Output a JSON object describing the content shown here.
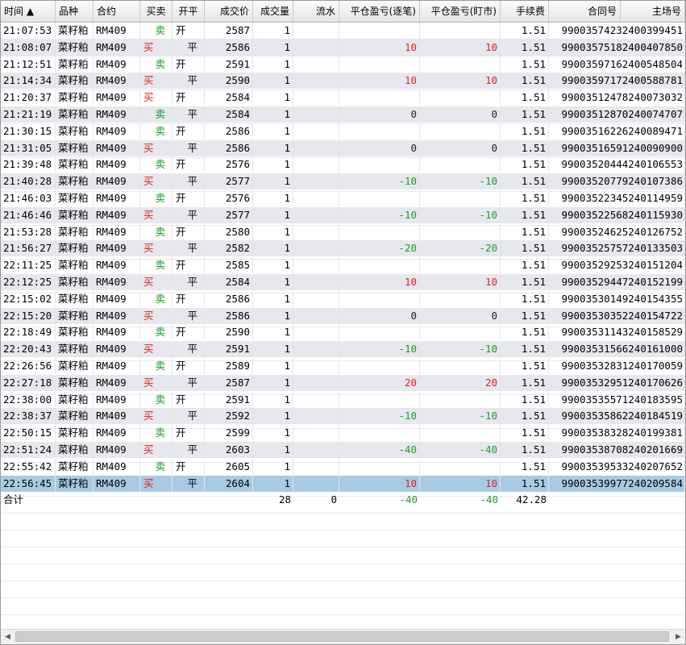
{
  "columns": [
    "时间 ▲",
    "品种",
    "合约",
    "买卖",
    "开平",
    "成交价",
    "成交量",
    "流水",
    "平仓盈亏(逐笔)",
    "平仓盈亏(盯市)",
    "手续费",
    "合同号",
    "主场号"
  ],
  "rows": [
    [
      "21:07:53",
      "菜籽粕",
      "RM409",
      "卖",
      "开",
      "2587",
      "1",
      "",
      "",
      "",
      "1.51",
      "99003574232400399451"
    ],
    [
      "21:08:07",
      "菜籽粕",
      "RM409",
      "买",
      "平",
      "2586",
      "1",
      "",
      "10",
      "10",
      "1.51",
      "99003575182400407850"
    ],
    [
      "21:12:51",
      "菜籽粕",
      "RM409",
      "卖",
      "开",
      "2591",
      "1",
      "",
      "",
      "",
      "1.51",
      "99003597162400548504"
    ],
    [
      "21:14:34",
      "菜籽粕",
      "RM409",
      "买",
      "平",
      "2590",
      "1",
      "",
      "10",
      "10",
      "1.51",
      "99003597172400588781"
    ],
    [
      "21:20:37",
      "菜籽粕",
      "RM409",
      "买",
      "开",
      "2584",
      "1",
      "",
      "",
      "",
      "1.51",
      "99003512478240073032"
    ],
    [
      "21:21:19",
      "菜籽粕",
      "RM409",
      "卖",
      "平",
      "2584",
      "1",
      "",
      "0",
      "0",
      "1.51",
      "99003512870240074707"
    ],
    [
      "21:30:15",
      "菜籽粕",
      "RM409",
      "卖",
      "开",
      "2586",
      "1",
      "",
      "",
      "",
      "1.51",
      "99003516226240089471"
    ],
    [
      "21:31:05",
      "菜籽粕",
      "RM409",
      "买",
      "平",
      "2586",
      "1",
      "",
      "0",
      "0",
      "1.51",
      "99003516591240090900"
    ],
    [
      "21:39:48",
      "菜籽粕",
      "RM409",
      "卖",
      "开",
      "2576",
      "1",
      "",
      "",
      "",
      "1.51",
      "99003520444240106553"
    ],
    [
      "21:40:28",
      "菜籽粕",
      "RM409",
      "买",
      "平",
      "2577",
      "1",
      "",
      "-10",
      "-10",
      "1.51",
      "99003520779240107386"
    ],
    [
      "21:46:03",
      "菜籽粕",
      "RM409",
      "卖",
      "开",
      "2576",
      "1",
      "",
      "",
      "",
      "1.51",
      "99003522345240114959"
    ],
    [
      "21:46:46",
      "菜籽粕",
      "RM409",
      "买",
      "平",
      "2577",
      "1",
      "",
      "-10",
      "-10",
      "1.51",
      "99003522568240115930"
    ],
    [
      "21:53:28",
      "菜籽粕",
      "RM409",
      "卖",
      "开",
      "2580",
      "1",
      "",
      "",
      "",
      "1.51",
      "99003524625240126752"
    ],
    [
      "21:56:27",
      "菜籽粕",
      "RM409",
      "买",
      "平",
      "2582",
      "1",
      "",
      "-20",
      "-20",
      "1.51",
      "99003525757240133503"
    ],
    [
      "22:11:25",
      "菜籽粕",
      "RM409",
      "卖",
      "开",
      "2585",
      "1",
      "",
      "",
      "",
      "1.51",
      "99003529253240151204"
    ],
    [
      "22:12:25",
      "菜籽粕",
      "RM409",
      "买",
      "平",
      "2584",
      "1",
      "",
      "10",
      "10",
      "1.51",
      "99003529447240152199"
    ],
    [
      "22:15:02",
      "菜籽粕",
      "RM409",
      "卖",
      "开",
      "2586",
      "1",
      "",
      "",
      "",
      "1.51",
      "99003530149240154355"
    ],
    [
      "22:15:20",
      "菜籽粕",
      "RM409",
      "买",
      "平",
      "2586",
      "1",
      "",
      "0",
      "0",
      "1.51",
      "99003530352240154722"
    ],
    [
      "22:18:49",
      "菜籽粕",
      "RM409",
      "卖",
      "开",
      "2590",
      "1",
      "",
      "",
      "",
      "1.51",
      "99003531143240158529"
    ],
    [
      "22:20:43",
      "菜籽粕",
      "RM409",
      "买",
      "平",
      "2591",
      "1",
      "",
      "-10",
      "-10",
      "1.51",
      "99003531566240161000"
    ],
    [
      "22:26:56",
      "菜籽粕",
      "RM409",
      "卖",
      "开",
      "2589",
      "1",
      "",
      "",
      "",
      "1.51",
      "99003532831240170059"
    ],
    [
      "22:27:18",
      "菜籽粕",
      "RM409",
      "买",
      "平",
      "2587",
      "1",
      "",
      "20",
      "20",
      "1.51",
      "99003532951240170626"
    ],
    [
      "22:38:00",
      "菜籽粕",
      "RM409",
      "卖",
      "开",
      "2591",
      "1",
      "",
      "",
      "",
      "1.51",
      "99003535571240183595"
    ],
    [
      "22:38:37",
      "菜籽粕",
      "RM409",
      "买",
      "平",
      "2592",
      "1",
      "",
      "-10",
      "-10",
      "1.51",
      "99003535862240184519"
    ],
    [
      "22:50:15",
      "菜籽粕",
      "RM409",
      "卖",
      "开",
      "2599",
      "1",
      "",
      "",
      "",
      "1.51",
      "99003538328240199381"
    ],
    [
      "22:51:24",
      "菜籽粕",
      "RM409",
      "买",
      "平",
      "2603",
      "1",
      "",
      "-40",
      "-40",
      "1.51",
      "99003538708240201669"
    ],
    [
      "22:55:42",
      "菜籽粕",
      "RM409",
      "卖",
      "开",
      "2605",
      "1",
      "",
      "",
      "",
      "1.51",
      "99003539533240207652"
    ],
    [
      "22:56:45",
      "菜籽粕",
      "RM409",
      "买",
      "平",
      "2604",
      "1",
      "",
      "10",
      "10",
      "1.51",
      "99003539977240209584"
    ]
  ],
  "total": {
    "label": "合计",
    "volume": "28",
    "flow": "0",
    "pnl_trade": "-40",
    "pnl_mark": "-40",
    "fee": "42.28"
  },
  "colors": {
    "buy": "#e0201e",
    "sell": "#1e9a2e",
    "selected": "#a7cbe2",
    "alt_row": "#e6e8ee"
  },
  "icons": {
    "sort": "sort-asc-icon",
    "scroll_left": "arrow-left-icon",
    "scroll_right": "arrow-right-icon"
  }
}
